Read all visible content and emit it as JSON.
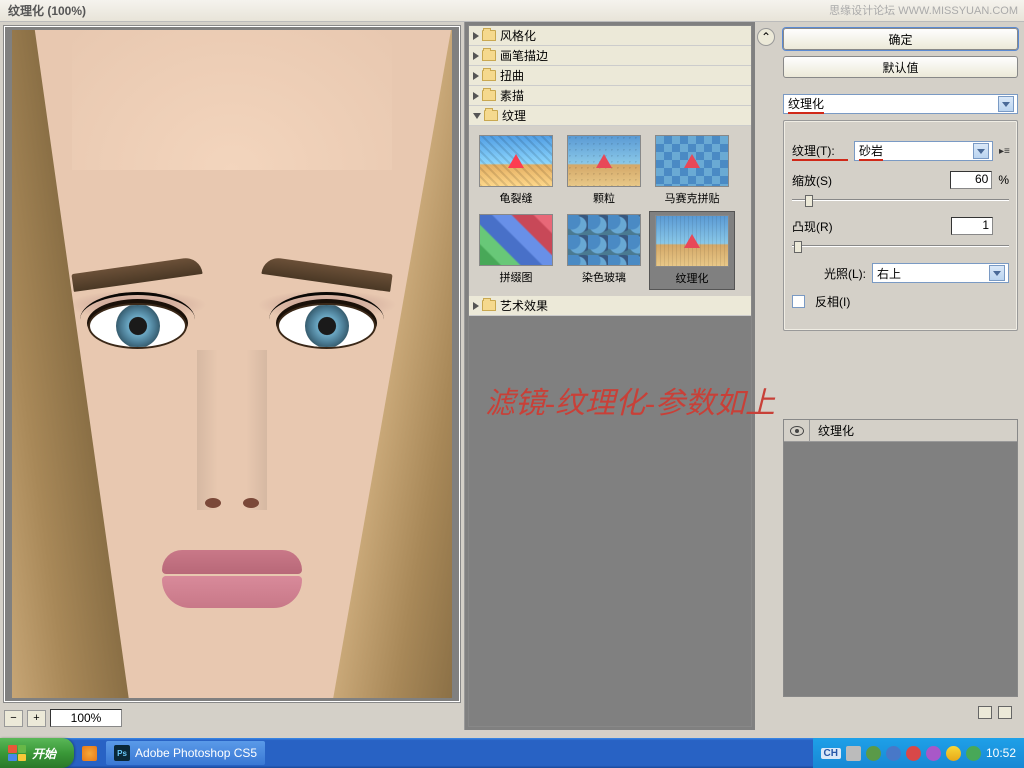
{
  "watermark": "思缘设计论坛  WWW.MISSYUAN.COM",
  "title": "纹理化  (100%)",
  "zoom_value": "100%",
  "categories": {
    "stylize": "风格化",
    "brush": "画笔描边",
    "distort": "扭曲",
    "sketch": "素描",
    "texture": "纹理",
    "artistic": "艺术效果"
  },
  "thumbs": {
    "crack": "龟裂缝",
    "grain": "颗粒",
    "mosaic": "马赛克拼贴",
    "patch": "拼缀图",
    "stained": "染色玻璃",
    "texturize": "纹理化"
  },
  "annotation": "滤镜-纹理化-参数如上",
  "buttons": {
    "ok": "确定",
    "default": "默认值"
  },
  "filter_select": "纹理化",
  "params": {
    "texture_label": "纹理(T):",
    "texture_value": "砂岩",
    "scale_label": "缩放(S)",
    "scale_value": "60",
    "scale_suffix": "%",
    "relief_label": "凸现(R)",
    "relief_value": "1",
    "light_label": "光照(L):",
    "light_value": "右上",
    "invert_label": "反相(I)"
  },
  "layer_name": "纹理化",
  "taskbar": {
    "start": "开始",
    "app": "Adobe Photoshop CS5",
    "lang": "CH",
    "clock": "10:52"
  }
}
